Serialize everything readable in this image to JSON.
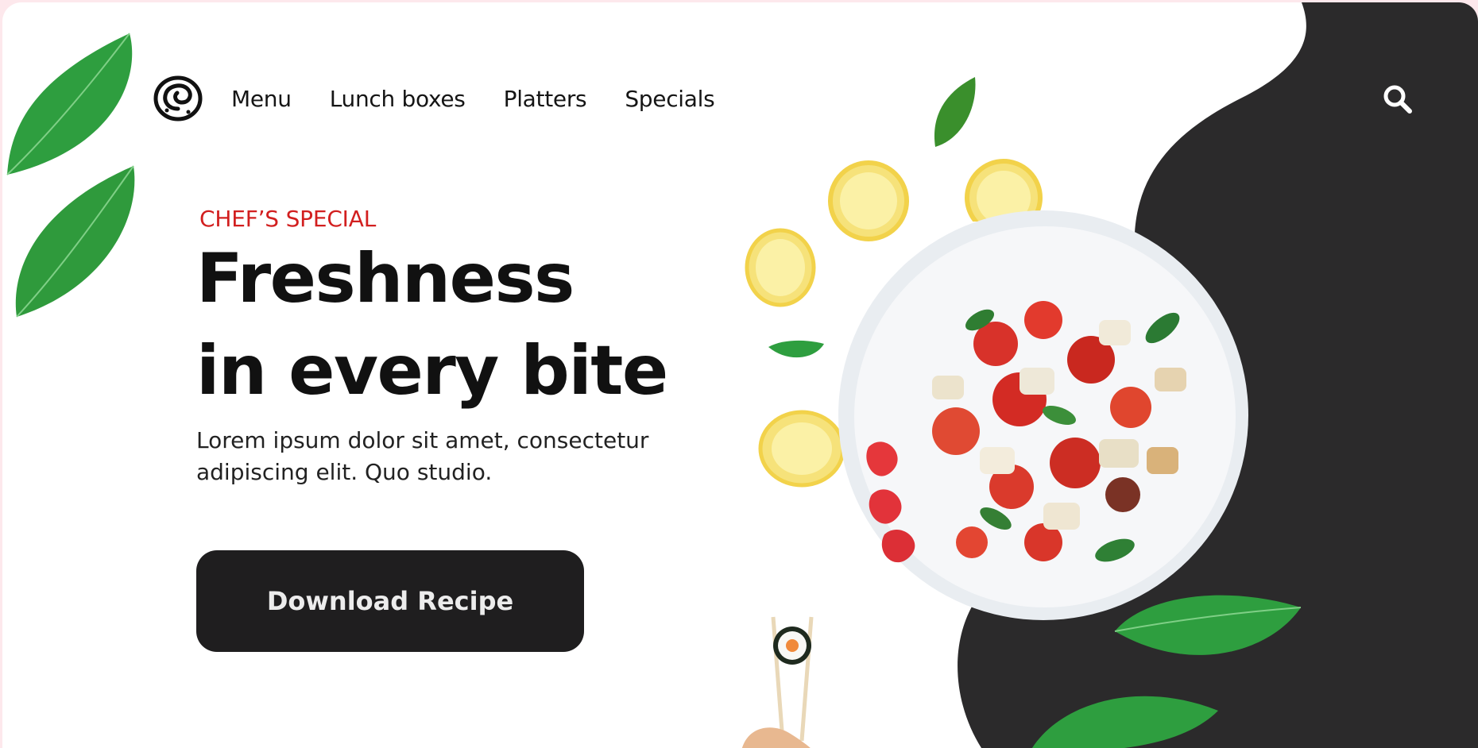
{
  "brand": {
    "logo_icon": "cinnamon-roll-icon"
  },
  "nav": {
    "items": [
      {
        "label": "Menu"
      },
      {
        "label": "Lunch boxes"
      },
      {
        "label": "Platters"
      },
      {
        "label": "Specials"
      }
    ],
    "search_icon": "search-icon"
  },
  "hero": {
    "eyebrow": "CHEF’S SPECIAL",
    "headline_line1": "Freshness",
    "headline_line2": "in every bite",
    "body": "Lorem ipsum dolor sit amet, consectetur adipiscing elit. Quo studio.",
    "cta_label": "Download Recipe"
  },
  "colors": {
    "accent": "#d21f1f",
    "dark": "#2b2a2b",
    "button": "#1f1e1f",
    "leaf": "#2e9e3f",
    "lemon": "#f3e36a"
  }
}
